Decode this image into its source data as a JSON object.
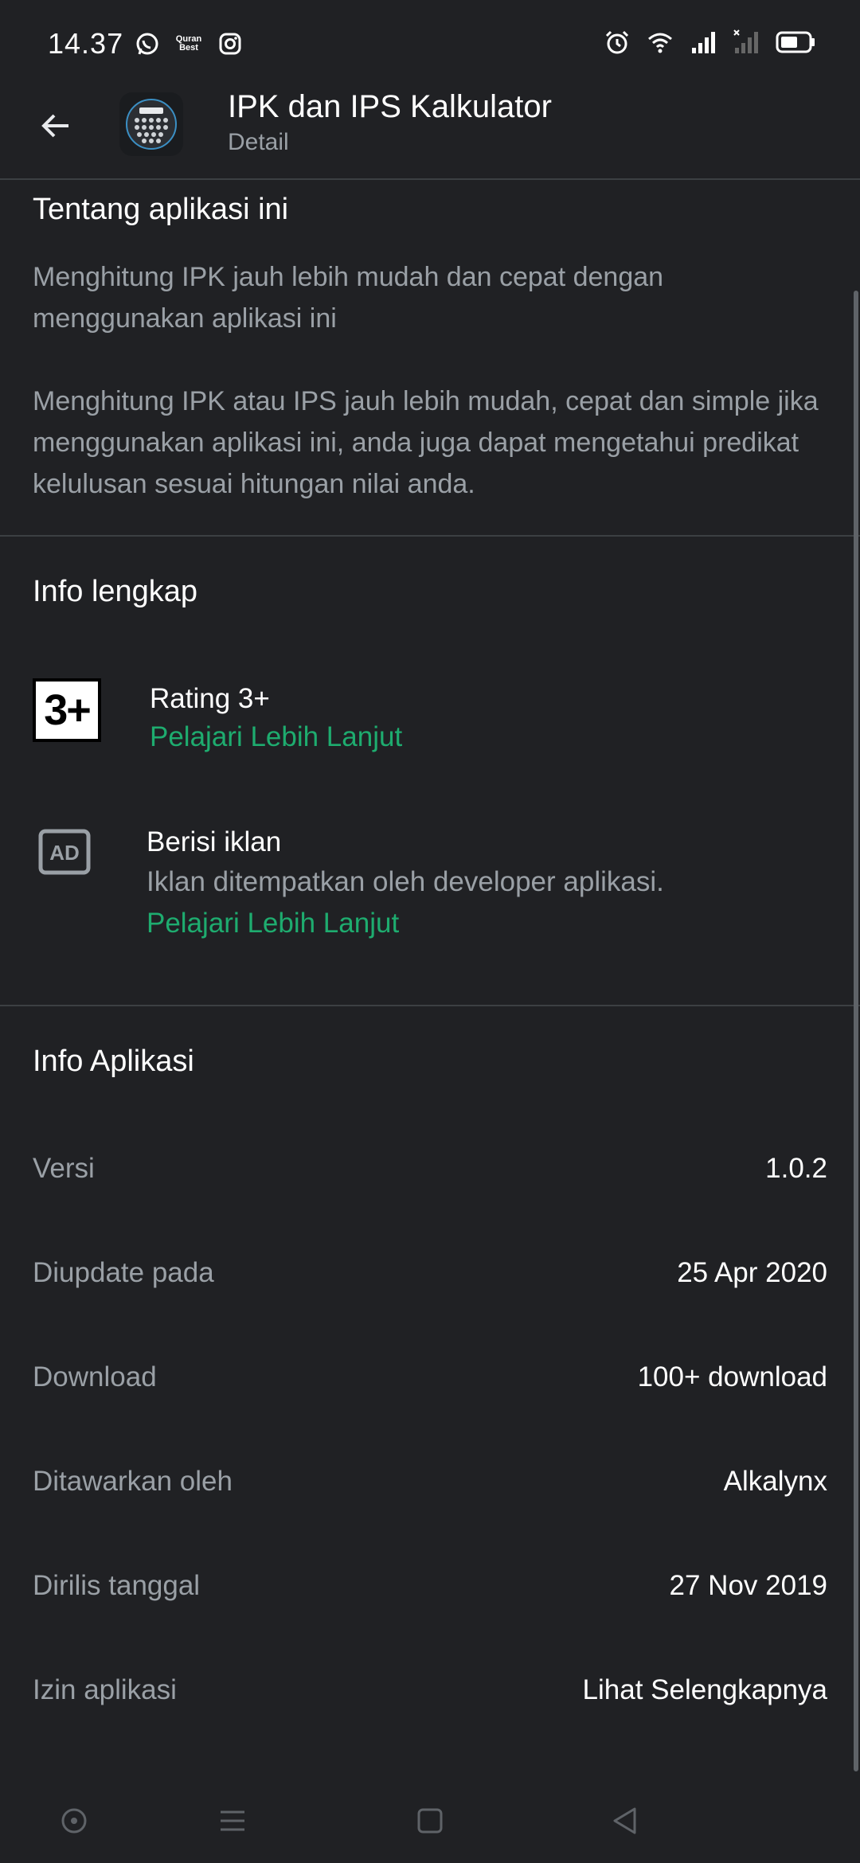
{
  "status_bar": {
    "time": "14.37",
    "left_icons": [
      "whatsapp-icon",
      "quran-best-icon",
      "instagram-icon"
    ],
    "quran_text_1": "Quran",
    "quran_text_2": "Best",
    "right_icons": [
      "alarm-icon",
      "wifi-icon",
      "signal-icon",
      "signal-x-icon",
      "battery-icon"
    ]
  },
  "app_bar": {
    "title": "IPK dan IPS Kalkulator",
    "subtitle": "Detail"
  },
  "about": {
    "title": "Tentang aplikasi ini",
    "short_description": "Menghitung IPK jauh lebih mudah dan cepat dengan menggunakan aplikasi ini",
    "long_description": "Menghitung IPK atau IPS jauh lebih mudah, cepat dan simple jika menggunakan aplikasi ini, anda juga dapat mengetahui predikat kelulusan sesuai hitungan nilai anda."
  },
  "full_info": {
    "title": "Info lengkap",
    "rating_badge": "3+",
    "rating_label": "Rating 3+",
    "rating_link": "Pelajari Lebih Lanjut",
    "ads_label": "Berisi iklan",
    "ads_description": "Iklan ditempatkan oleh developer aplikasi.",
    "ads_link": "Pelajari Lebih Lanjut"
  },
  "app_info": {
    "title": "Info Aplikasi",
    "rows": [
      {
        "label": "Versi",
        "value": "1.0.2"
      },
      {
        "label": "Diupdate pada",
        "value": "25 Apr 2020"
      },
      {
        "label": "Download",
        "value": "100+ download"
      },
      {
        "label": "Ditawarkan oleh",
        "value": "Alkalynx"
      },
      {
        "label": "Dirilis tanggal",
        "value": "27 Nov 2019"
      },
      {
        "label": "Izin aplikasi",
        "value": "Lihat Selengkapnya"
      }
    ]
  },
  "colors": {
    "background": "#202124",
    "link": "#1eac6f",
    "secondary_text": "#9aa0a6",
    "divider": "#3c4043"
  }
}
